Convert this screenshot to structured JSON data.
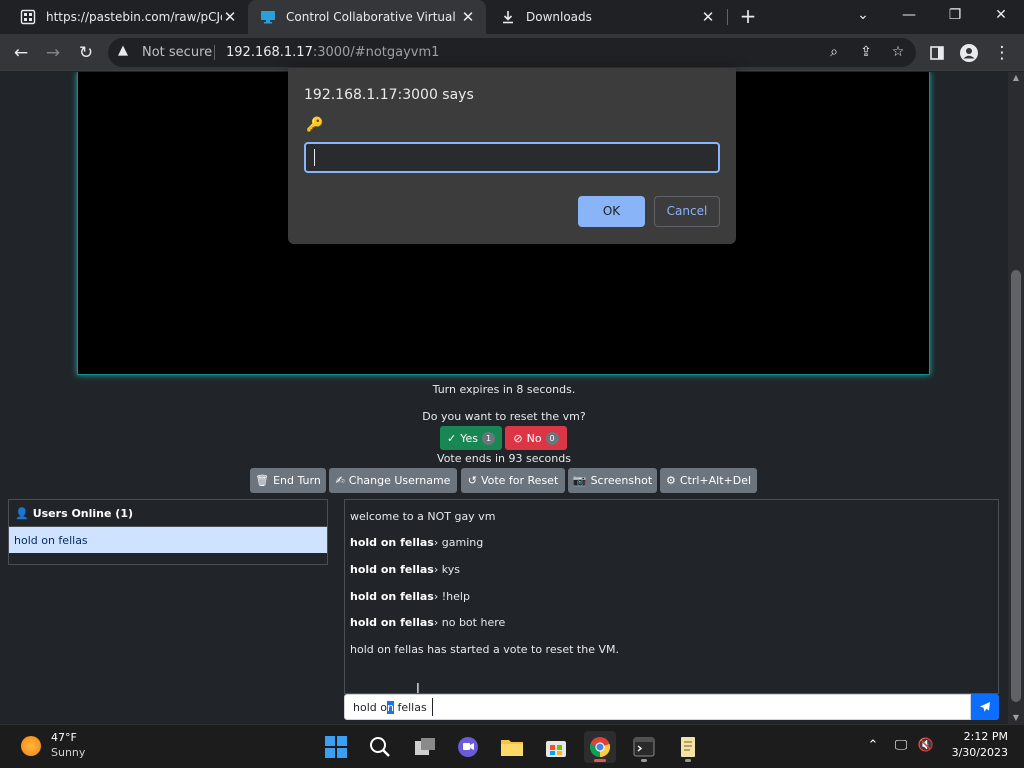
{
  "tabs": [
    {
      "title": "https://pastebin.com/raw/pCJqb",
      "icon": "pastebin-icon"
    },
    {
      "title": "Control Collaborative Virtual Ma",
      "icon": "monitor-icon"
    },
    {
      "title": "Downloads",
      "icon": "download-icon"
    }
  ],
  "toolbar": {
    "not_secure": "Not secure",
    "url_host": "192.168.1.17",
    "url_path": ":3000/#notgayvm1"
  },
  "vm": {
    "turn_text": "Turn expires in 8 seconds.",
    "vote_question": "Do you want to reset the vm?",
    "yes_label": "Yes",
    "yes_count": "1",
    "no_label": "No",
    "no_count": "0",
    "vote_ends": "Vote ends in 93 seconds"
  },
  "actions": {
    "end_turn": "End Turn",
    "change_username": "Change Username",
    "vote_reset": "Vote for Reset",
    "screenshot": "Screenshot",
    "cad": "Ctrl+Alt+Del"
  },
  "users": {
    "header": "Users Online (1)",
    "list": [
      "hold on fellas"
    ]
  },
  "chat": {
    "messages": [
      {
        "user": "",
        "text": "welcome to a NOT gay vm"
      },
      {
        "user": "hold on fellas",
        "text": "gaming"
      },
      {
        "user": "hold on fellas",
        "text": "kys"
      },
      {
        "user": "hold on fellas",
        "text": "!help"
      },
      {
        "user": "hold on fellas",
        "text": "no bot here"
      },
      {
        "user": "",
        "text": "hold on fellas has started a vote to reset the VM."
      }
    ],
    "separator": "›",
    "input_before": "hold o",
    "input_selected": "n",
    "input_after": " fellas"
  },
  "dialog": {
    "title": "192.168.1.17:3000 says",
    "ok": "OK",
    "cancel": "Cancel"
  },
  "taskbar": {
    "temp": "47°F",
    "weather": "Sunny",
    "time": "2:12 PM",
    "date": "3/30/2023"
  },
  "colors": {
    "yes": "#198754",
    "no": "#dc3545",
    "action": "#6c757d",
    "send": "#0d6efd",
    "user_highlight": "#cfe2ff",
    "dialog_accent": "#8ab4f8"
  }
}
